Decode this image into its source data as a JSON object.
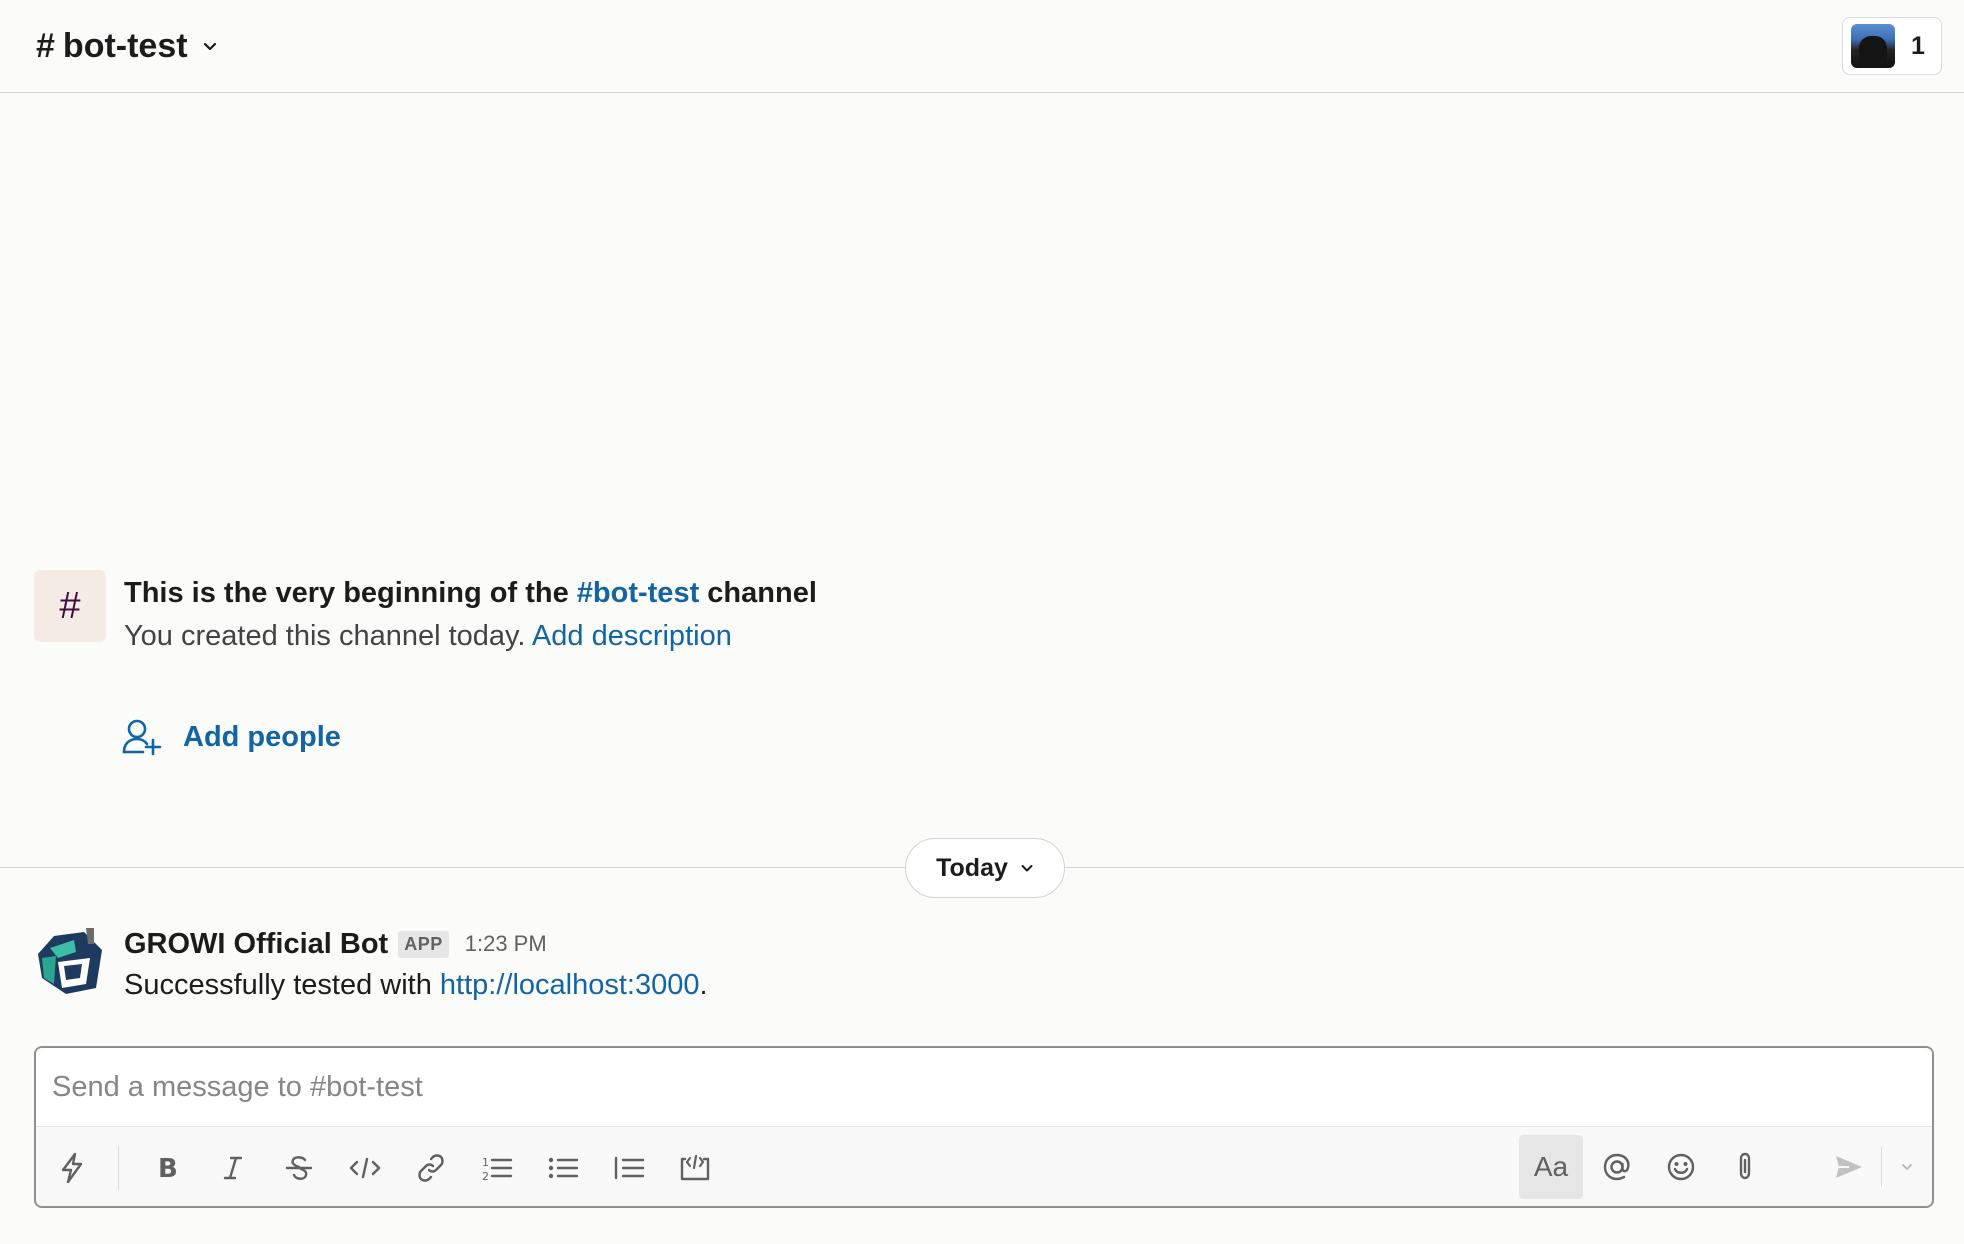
{
  "header": {
    "channel_hash": "#",
    "channel_name": "bot-test",
    "member_count": "1"
  },
  "intro": {
    "icon_glyph": "#",
    "line1_prefix": "This is the very beginning of the ",
    "line1_channel": "#bot-test",
    "line1_suffix": " channel",
    "line2_text": "You created this channel today. ",
    "line2_link": "Add description",
    "add_people": "Add people"
  },
  "divider": {
    "label": "Today"
  },
  "message": {
    "sender": "GROWI Official Bot",
    "badge": "APP",
    "time": "1:23 PM",
    "body_prefix": "Successfully tested with ",
    "body_link": "http://localhost:3000",
    "body_suffix": "."
  },
  "composer": {
    "placeholder": "Send a message to #bot-test",
    "aa_label": "Aa"
  },
  "colors": {
    "link": "#1264a3",
    "background": "#fbfbfa",
    "aubergine": "#3f0e40"
  },
  "icons": [
    "chevron-down-icon",
    "lightning-icon",
    "bold-icon",
    "italic-icon",
    "strikethrough-icon",
    "code-icon",
    "link-icon",
    "ordered-list-icon",
    "bulleted-list-icon",
    "blockquote-icon",
    "code-block-icon",
    "at-icon",
    "emoji-icon",
    "attachment-icon",
    "send-icon",
    "add-person-icon"
  ]
}
